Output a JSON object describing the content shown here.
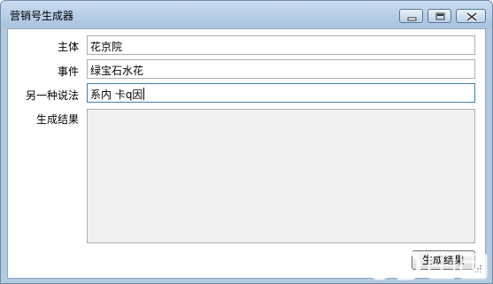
{
  "window": {
    "title": "营销号生成器"
  },
  "form": {
    "subject_label": "主体",
    "subject_value": "花京院",
    "event_label": "事件",
    "event_value": "绿宝石水花",
    "alias_label": "另一种说法",
    "alias_value": "系内 卡q因",
    "result_label": "生成结果",
    "result_value": ""
  },
  "actions": {
    "generate_label": "生成结果"
  },
  "icons": [
    "minimize-icon",
    "maximize-icon",
    "close-icon",
    "size-grip-icon"
  ],
  "colors": {
    "titlebar": "#b3c9e0",
    "result_background": "#f0f0f0",
    "focus_border": "#3c7fb1"
  }
}
